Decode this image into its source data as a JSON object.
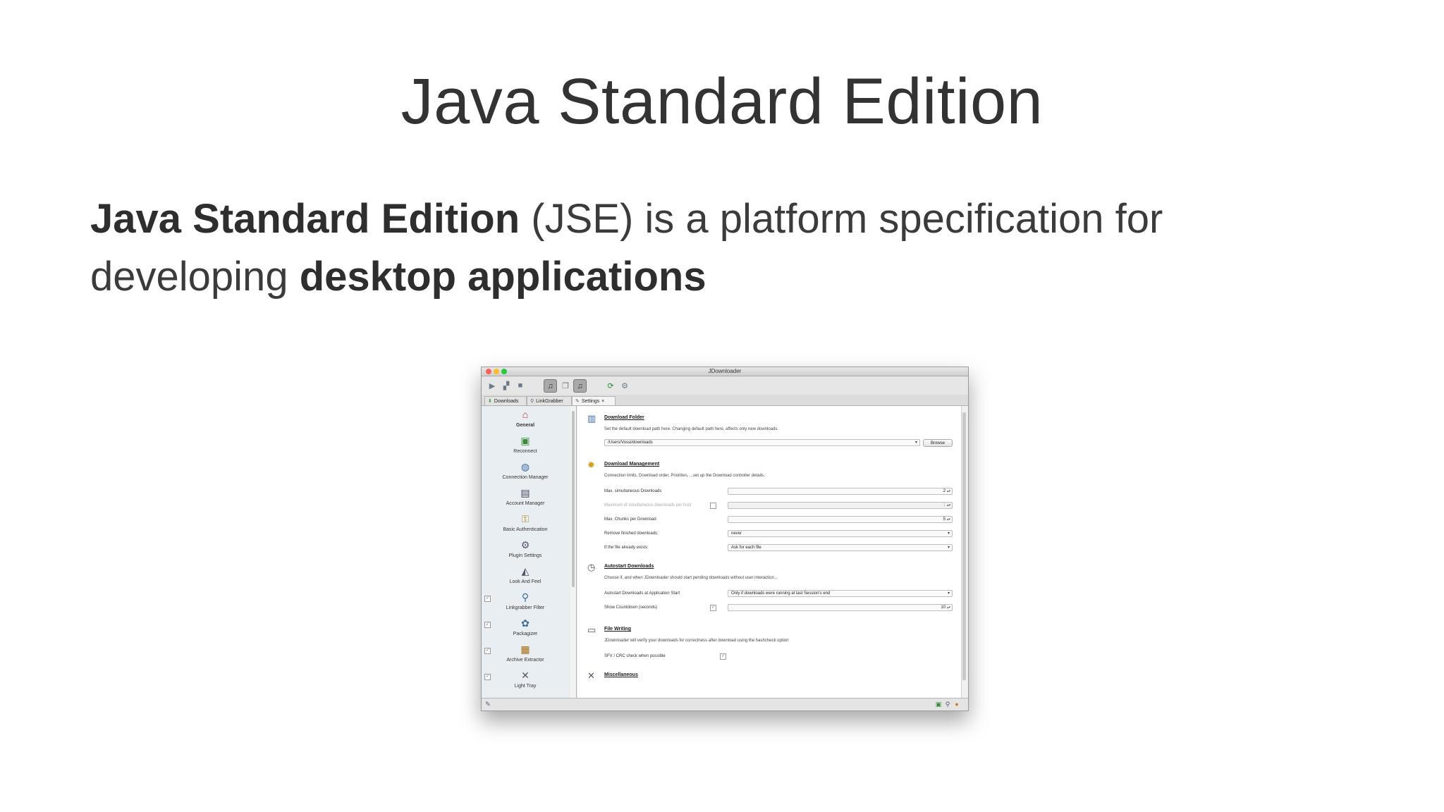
{
  "slide": {
    "title": "Java Standard Edition",
    "line1_bold": "Java Standard Edition",
    "line1_rest": " (JSE) is a platform specification for",
    "line2_start": "developing ",
    "line2_bold": "desktop applications"
  },
  "window": {
    "title": "JDownloader",
    "tabs": [
      {
        "label": "Downloads",
        "icon": "download-icon"
      },
      {
        "label": "LinkGrabber",
        "icon": "linkgrabber-icon"
      },
      {
        "label": "Settings",
        "icon": "settings-icon",
        "close": "×"
      }
    ],
    "sidebar": [
      {
        "label": "General",
        "icon": "home-icon"
      },
      {
        "label": "Reconnect",
        "icon": "reconnect-icon"
      },
      {
        "label": "Connection Manager",
        "icon": "connection-icon"
      },
      {
        "label": "Account Manager",
        "icon": "account-icon"
      },
      {
        "label": "Basic Authentication",
        "icon": "authentication-icon"
      },
      {
        "label": "Plugin Settings",
        "icon": "plugin-icon"
      },
      {
        "label": "Look And Feel",
        "icon": "paint-icon"
      },
      {
        "label": "Linkgrabber Filter",
        "icon": "filter-icon"
      },
      {
        "label": "Packagizer",
        "icon": "packagizer-icon"
      },
      {
        "label": "Archive Extractor",
        "icon": "archive-icon"
      },
      {
        "label": "Light Tray",
        "icon": "tray-icon"
      }
    ],
    "sections": {
      "download_folder": {
        "heading": "Download Folder",
        "desc": "Set the default download path here. Changing default path here, affects only new downloads.",
        "path": "/Users/Vossi/downloads",
        "browse": "Browse"
      },
      "download_management": {
        "heading": "Download Management",
        "desc": "Connection limits, Download order, Priorities, ...set up the Download controller details.",
        "rows": [
          {
            "label": "Max. simultaneous Downloads",
            "value": "2"
          },
          {
            "label": "Maximum of simultaneous downloads per host",
            "value": "1"
          },
          {
            "label": "Max. Chunks per Download",
            "value": "5"
          },
          {
            "label": "Remove finished downloads:",
            "value": "never"
          },
          {
            "label": "If the file already exists:",
            "value": "Ask for each file"
          }
        ]
      },
      "autostart": {
        "heading": "Autostart Downloads",
        "desc": "Choose if, and when JDownloader should start pending downloads without user interaction...",
        "rows": [
          {
            "label": "Autostart Downloads at Application Start",
            "value": "Only if downloads were running at last Session's end"
          },
          {
            "label": "Show Countdown (seconds)",
            "value": "10"
          }
        ]
      },
      "file_writing": {
        "heading": "File Writing",
        "desc": "JDownloader will verify your downloads for correctness after download using the hashcheck option",
        "row": {
          "label": "SFV / CRC check when possible"
        }
      },
      "misc": {
        "heading": "Miscellaneous"
      }
    },
    "glyphs": {
      "check": "✓",
      "spin": "▴▾",
      "dropdown": "▾",
      "scroll_up": "▲",
      "scroll_down": "▼"
    }
  }
}
